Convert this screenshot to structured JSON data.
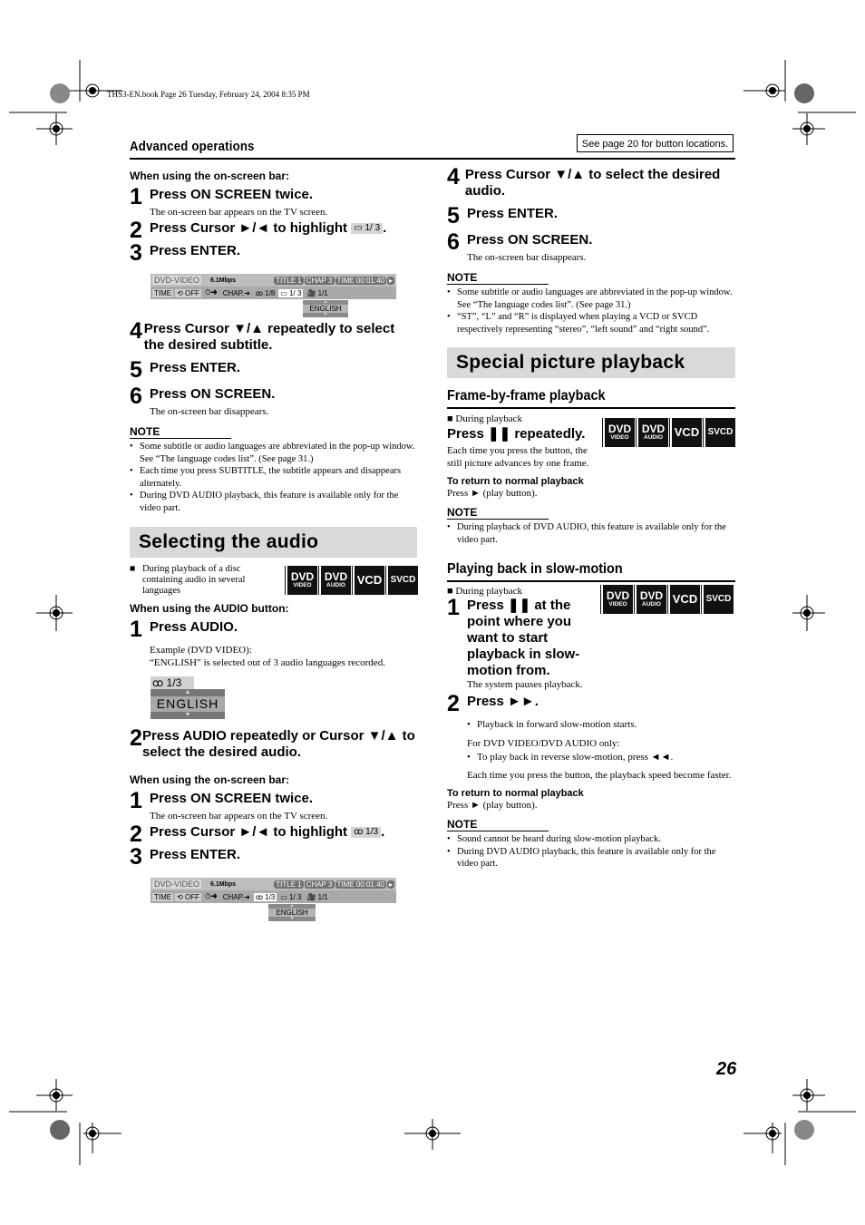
{
  "header": {
    "file_info": "THS3-EN.book  Page 26  Tuesday, February 24, 2004  8:35 PM",
    "section": "Advanced operations",
    "see_page": "See page 20 for button locations."
  },
  "page_number": "26",
  "left": {
    "subtitle_onscreen": {
      "heading": "When using the on-screen bar:",
      "steps": [
        {
          "num": "1",
          "text": "Press ON SCREEN twice.",
          "sub": "The on-screen bar appears on the TV screen."
        },
        {
          "num": "2",
          "text_before": "Press Cursor ►/◄ to highlight",
          "highlight": "1/ 3",
          "text_after": "."
        },
        {
          "num": "3",
          "text": "Press ENTER."
        },
        {
          "num": "4",
          "text": "Press Cursor ▼/▲ repeatedly to select the desired subtitle."
        },
        {
          "num": "5",
          "text": "Press ENTER."
        },
        {
          "num": "6",
          "text": "Press ON SCREEN.",
          "sub": "The on-screen bar disappears."
        }
      ],
      "note_title": "NOTE",
      "notes": [
        "Some subtitle or audio languages are abbreviated in the pop-up window. See “The language codes list”. (See page 31.)",
        "Each time you press SUBTITLE, the subtitle appears and disappears alternately.",
        "During DVD AUDIO playback, this feature is available only for the video part."
      ]
    },
    "osb1": {
      "disc": "DVD-VIDEO",
      "rate": "6.1Mbps",
      "title": "TITLE  1",
      "chap": "CHAP  3",
      "time": "TIME 00:01:40",
      "row2": [
        "TIME",
        "⟲ OFF",
        "⏱➜",
        "CHAP.➜",
        "ꝏ 1/8",
        "▭ 1/ 3",
        "🎥 1/1"
      ],
      "popup": "ENGLISH"
    },
    "audio_section": {
      "title": "Selecting the audio",
      "condition": "During playback of a disc containing audio in several languages",
      "audio_button_heading": "When using the AUDIO button:",
      "step1": {
        "num": "1",
        "text": "Press AUDIO.",
        "example": "Example (DVD VIDEO):",
        "desc": "“ENGLISH” is selected out of 3 audio languages recorded."
      },
      "popup": {
        "count": "ꝏ 1/3",
        "label": "ENGLISH"
      },
      "step2": {
        "num": "2",
        "text": "Press AUDIO repeatedly or Cursor ▼/▲ to select the desired audio."
      },
      "onscreen_heading": "When using the on-screen bar:",
      "onscreen_steps": [
        {
          "num": "1",
          "text": "Press ON SCREEN twice.",
          "sub": "The on-screen bar appears on the TV screen."
        },
        {
          "num": "2",
          "text_before": "Press Cursor ►/◄ to highlight",
          "highlight": "ꝏ 1/3",
          "text_after": "."
        },
        {
          "num": "3",
          "text": "Press ENTER."
        }
      ]
    },
    "osb2": {
      "disc": "DVD-VIDEO",
      "rate": "6.1Mbps",
      "title": "TITLE  1",
      "chap": "CHAP  3",
      "time": "TIME 00:01:40",
      "row2": [
        "TIME",
        "⟲ OFF",
        "⏱➜",
        "CHAP.➜",
        "ꝏ 1/3",
        "▭ 1/ 3",
        "🎥 1/1"
      ],
      "popup": "ENGLISH"
    }
  },
  "right": {
    "audio_cont": {
      "steps": [
        {
          "num": "4",
          "text": "Press Cursor ▼/▲ to select the desired audio."
        },
        {
          "num": "5",
          "text": "Press ENTER."
        },
        {
          "num": "6",
          "text": "Press ON SCREEN.",
          "sub": "The on-screen bar disappears."
        }
      ],
      "note_title": "NOTE",
      "notes": [
        "Some subtitle or audio languages are abbreviated in the pop-up window. See “The language codes list”. (See page 31.)",
        "“ST”, “L” and “R” is displayed when playing a VCD or SVCD respectively representing “stereo”, “left sound” and “right sound”."
      ]
    },
    "special": {
      "title": "Special picture playback",
      "frame": {
        "heading": "Frame-by-frame playback",
        "condition": "During playback",
        "action": "Press ❚❚ repeatedly.",
        "desc": "Each time you press the button, the still picture advances by one frame.",
        "return_title": "To return to normal playback",
        "return_text": "Press ► (play button).",
        "note_title": "NOTE",
        "notes": [
          "During playback of DVD AUDIO, this feature is available only for the video part."
        ]
      },
      "slow": {
        "heading": "Playing back in slow-motion",
        "condition": "During playback",
        "step1": {
          "num": "1",
          "text": "Press ❚❚ at the point where you want to start playback in slow-motion from.",
          "sub": "The system pauses playback."
        },
        "step2": {
          "num": "2",
          "text": "Press ►►."
        },
        "bullet1": "Playback in forward slow-motion starts.",
        "dvd_only": "For DVD VIDEO/DVD AUDIO only:",
        "bullet2": "To play back in reverse slow-motion, press ◄◄.",
        "speed": "Each time you press the button, the playback speed become faster.",
        "return_title": "To return to normal playback",
        "return_text": "Press ► (play button).",
        "note_title": "NOTE",
        "notes": [
          "Sound cannot be heard during slow-motion playback.",
          "During DVD AUDIO playback, this feature is available only for the video part."
        ]
      }
    }
  },
  "disc_badges": [
    {
      "top": "DVD",
      "bottom": "VIDEO"
    },
    {
      "top": "DVD",
      "bottom": "AUDIO"
    },
    {
      "top": "VCD",
      "bottom": ""
    },
    {
      "top": "SVCD",
      "bottom": ""
    }
  ]
}
